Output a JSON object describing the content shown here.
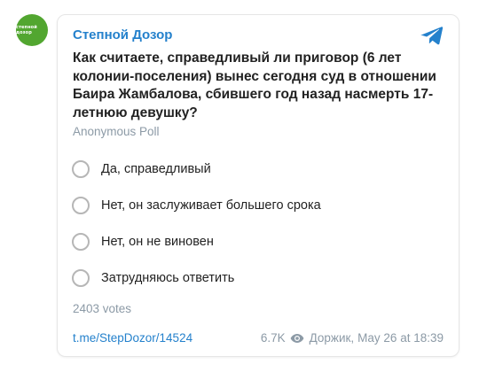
{
  "channel": {
    "avatar_text": "степной дозор",
    "name": "Степной Дозор",
    "brand_color": "#2481cc",
    "avatar_color": "#52a630"
  },
  "poll": {
    "question": "Как считаете, справедливый ли приговор (6 лет колонии-поселения) вынес сегодня суд в отношении Баира Жамбалова, сбившего год назад насмерть 17-летнюю девушку?",
    "type_label": "Anonymous Poll",
    "options": [
      "Да, справедливый",
      "Нет, он заслуживает большего срока",
      "Нет, он не виновен",
      "Затрудняюсь ответить"
    ],
    "votes_label": "2403 votes"
  },
  "footer": {
    "link_text": "t.me/StepDozor/14524",
    "views": "6.7K",
    "author": "Доржик,",
    "date": "May 26 at 18:39"
  },
  "icons": {
    "telegram": "telegram-plane-icon",
    "views": "eye-icon"
  }
}
